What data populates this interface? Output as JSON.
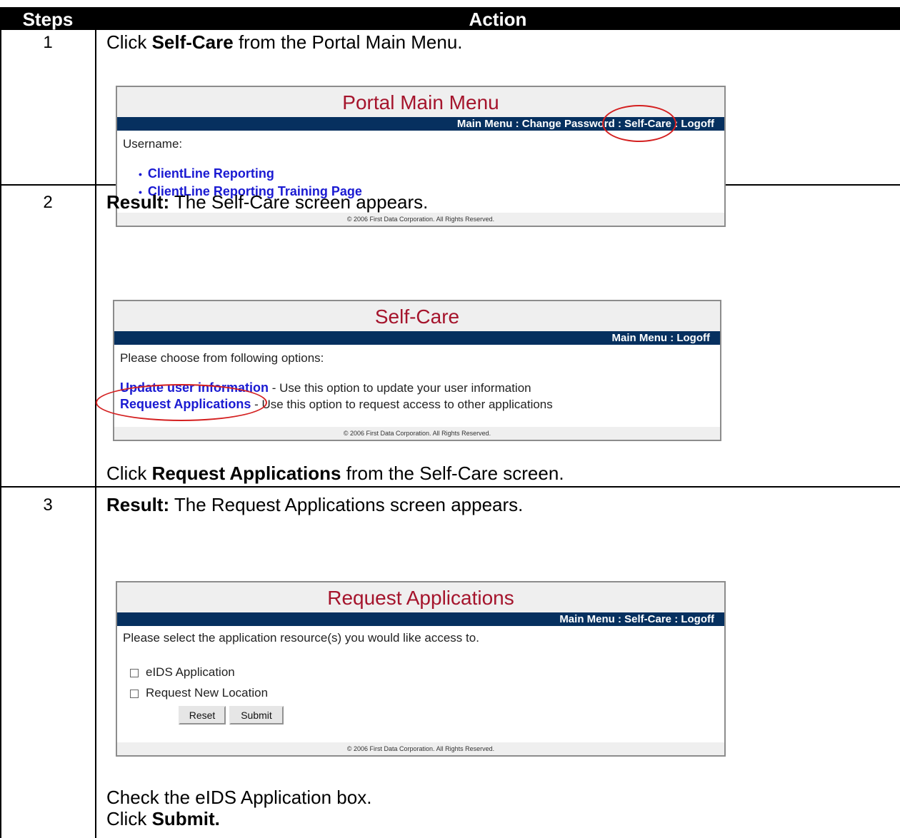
{
  "table": {
    "header": {
      "steps": "Steps",
      "action": "Action"
    },
    "rows": [
      {
        "num": "1",
        "prefix": "Click ",
        "bold": "Self-Care",
        "suffix": " from the Portal Main Menu."
      },
      {
        "num": "2",
        "result_label": "Result:",
        "result_text": " The Self-Care screen appears.",
        "instr_prefix": "Click ",
        "instr_bold": "Request Applications",
        "instr_suffix": " from the Self-Care screen."
      },
      {
        "num": "3",
        "result_label": "Result:",
        "result_text": " The Request Applications screen appears.",
        "line1": "Check the eIDS Application box.",
        "line2_prefix": "Click ",
        "line2_bold": "Submit."
      }
    ]
  },
  "portal_main_menu": {
    "title": "Portal Main Menu",
    "nav": [
      "Main Menu",
      "Change Password",
      "Self-Care",
      "Logoff"
    ],
    "username_label": "Username:",
    "links": [
      "ClientLine Reporting",
      "ClientLine Reporting Training Page"
    ],
    "footer": "© 2006 First Data Corporation. All Rights Reserved."
  },
  "self_care": {
    "title": "Self-Care",
    "nav": [
      "Main Menu",
      "Logoff"
    ],
    "prompt": "Please choose from following options:",
    "options": [
      {
        "link": "Update user information",
        "desc": " - Use this option to update your user information"
      },
      {
        "link": "Request Applications",
        "desc": " - Use this option to request access to other applications"
      }
    ],
    "footer": "© 2006 First Data Corporation. All Rights Reserved."
  },
  "request_applications": {
    "title": "Request Applications",
    "nav": [
      "Main Menu",
      "Self-Care",
      "Logoff"
    ],
    "prompt": "Please select the application resource(s) you would like access to.",
    "checkboxes": [
      "eIDS Application",
      "Request New Location"
    ],
    "reset_label": "Reset",
    "submit_label": "Submit",
    "footer": "© 2006 First Data Corporation. All Rights Reserved."
  },
  "colors": {
    "nav_bg": "#06305f",
    "title_red": "#a5142c",
    "link_blue": "#1a1ad2",
    "highlight_circle": "#d42020"
  }
}
